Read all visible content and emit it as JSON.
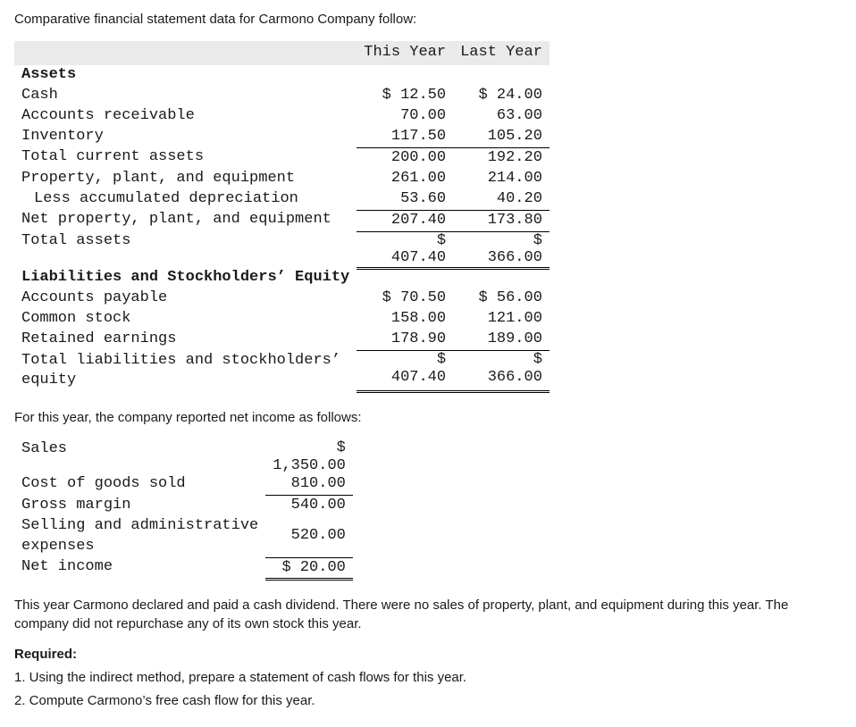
{
  "intro": "Comparative financial statement data for Carmono Company follow:",
  "bs": {
    "hdr_this": "This Year",
    "hdr_last": "Last Year",
    "assets_head": "Assets",
    "cash_lbl": "Cash",
    "cash_ty": "$ 12.50",
    "cash_ly": "$ 24.00",
    "ar_lbl": "Accounts receivable",
    "ar_ty": "70.00",
    "ar_ly": "63.00",
    "inv_lbl": "Inventory",
    "inv_ty": "117.50",
    "inv_ly": "105.20",
    "tca_lbl": "Total current assets",
    "tca_ty": "200.00",
    "tca_ly": "192.20",
    "ppe_lbl": "Property, plant, and equipment",
    "ppe_ty": "261.00",
    "ppe_ly": "214.00",
    "accdep_lbl": "Less accumulated depreciation",
    "accdep_ty": "53.60",
    "accdep_ly": "40.20",
    "netppe_lbl": "Net property, plant, and equipment",
    "netppe_ty": "207.40",
    "netppe_ly": "173.80",
    "ta_lbl": "Total assets",
    "ta_ty_top": "$",
    "ta_ty_bot": "407.40",
    "ta_ly_top": "$",
    "ta_ly_bot": "366.00",
    "lse_head": "Liabilities and Stockholders’ Equity",
    "ap_lbl": "Accounts payable",
    "ap_ty": "$ 70.50",
    "ap_ly": "$ 56.00",
    "cs_lbl": "Common stock",
    "cs_ty": "158.00",
    "cs_ly": "121.00",
    "re_lbl": "Retained earnings",
    "re_ty": "178.90",
    "re_ly": "189.00",
    "tlse_lbl1": "Total liabilities and stockholders’",
    "tlse_lbl2": "equity",
    "tlse_ty_top": "$",
    "tlse_ty_bot": "407.40",
    "tlse_ly_top": "$",
    "tlse_ly_bot": "366.00"
  },
  "is_intro": "For this year, the company reported net income as follows:",
  "is": {
    "sales_lbl": "Sales",
    "sales_top": "$",
    "sales_bot": "1,350.00",
    "cogs_lbl": "Cost of goods sold",
    "cogs": "810.00",
    "gm_lbl": "Gross margin",
    "gm": "540.00",
    "sae_lbl1": "Selling and administrative",
    "sae_lbl2": "expenses",
    "sae": "520.00",
    "ni_lbl": "Net income",
    "ni": "$ 20.00"
  },
  "note": "This year Carmono declared and paid a cash dividend. There were no sales of property, plant, and equipment during this year. The company did not repurchase any of its own stock this year.",
  "req_head": "Required:",
  "req1": "1. Using the indirect method, prepare a statement of cash flows for this year.",
  "req2": "2. Compute Carmono’s free cash flow for this year."
}
